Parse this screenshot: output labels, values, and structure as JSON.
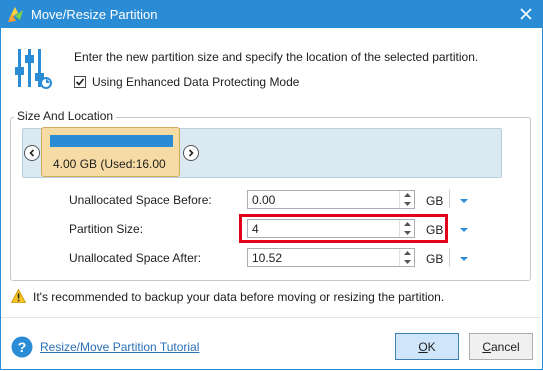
{
  "window": {
    "title": "Move/Resize Partition",
    "accent_color": "#2b8cd6",
    "app_icon": "partition-wizard-icon",
    "close_icon": "close-icon"
  },
  "header": {
    "icon": "sliders-icon",
    "description": "Enter the new partition size and specify the location of the selected partition.",
    "checkbox_label": "Using Enhanced Data Protecting Mode",
    "checkbox_checked": true
  },
  "size_location": {
    "legend": "Size And Location",
    "partition_label": "4.00 GB (Used:16.00",
    "left_arrow_icon": "chevron-left-icon",
    "right_arrow_icon": "chevron-right-icon"
  },
  "fields": {
    "unallocated_before": {
      "label": "Unallocated Space Before:",
      "value": "0.00",
      "unit": "GB"
    },
    "partition_size": {
      "label": "Partition Size:",
      "value": "4",
      "unit": "GB",
      "highlighted": true,
      "highlight_color": "#e3001b"
    },
    "unallocated_after": {
      "label": "Unallocated Space After:",
      "value": "10.52",
      "unit": "GB"
    }
  },
  "warning": {
    "icon": "warning-icon",
    "text": "It's recommended to backup your data before moving or resizing the partition."
  },
  "footer": {
    "help_icon": "help-icon",
    "tutorial_link": "Resize/Move Partition Tutorial",
    "ok_label": "OK",
    "ok_underline": "O",
    "ok_rest": "K",
    "cancel_label": "Cancel",
    "cancel_underline": "C",
    "cancel_rest": "ancel"
  }
}
